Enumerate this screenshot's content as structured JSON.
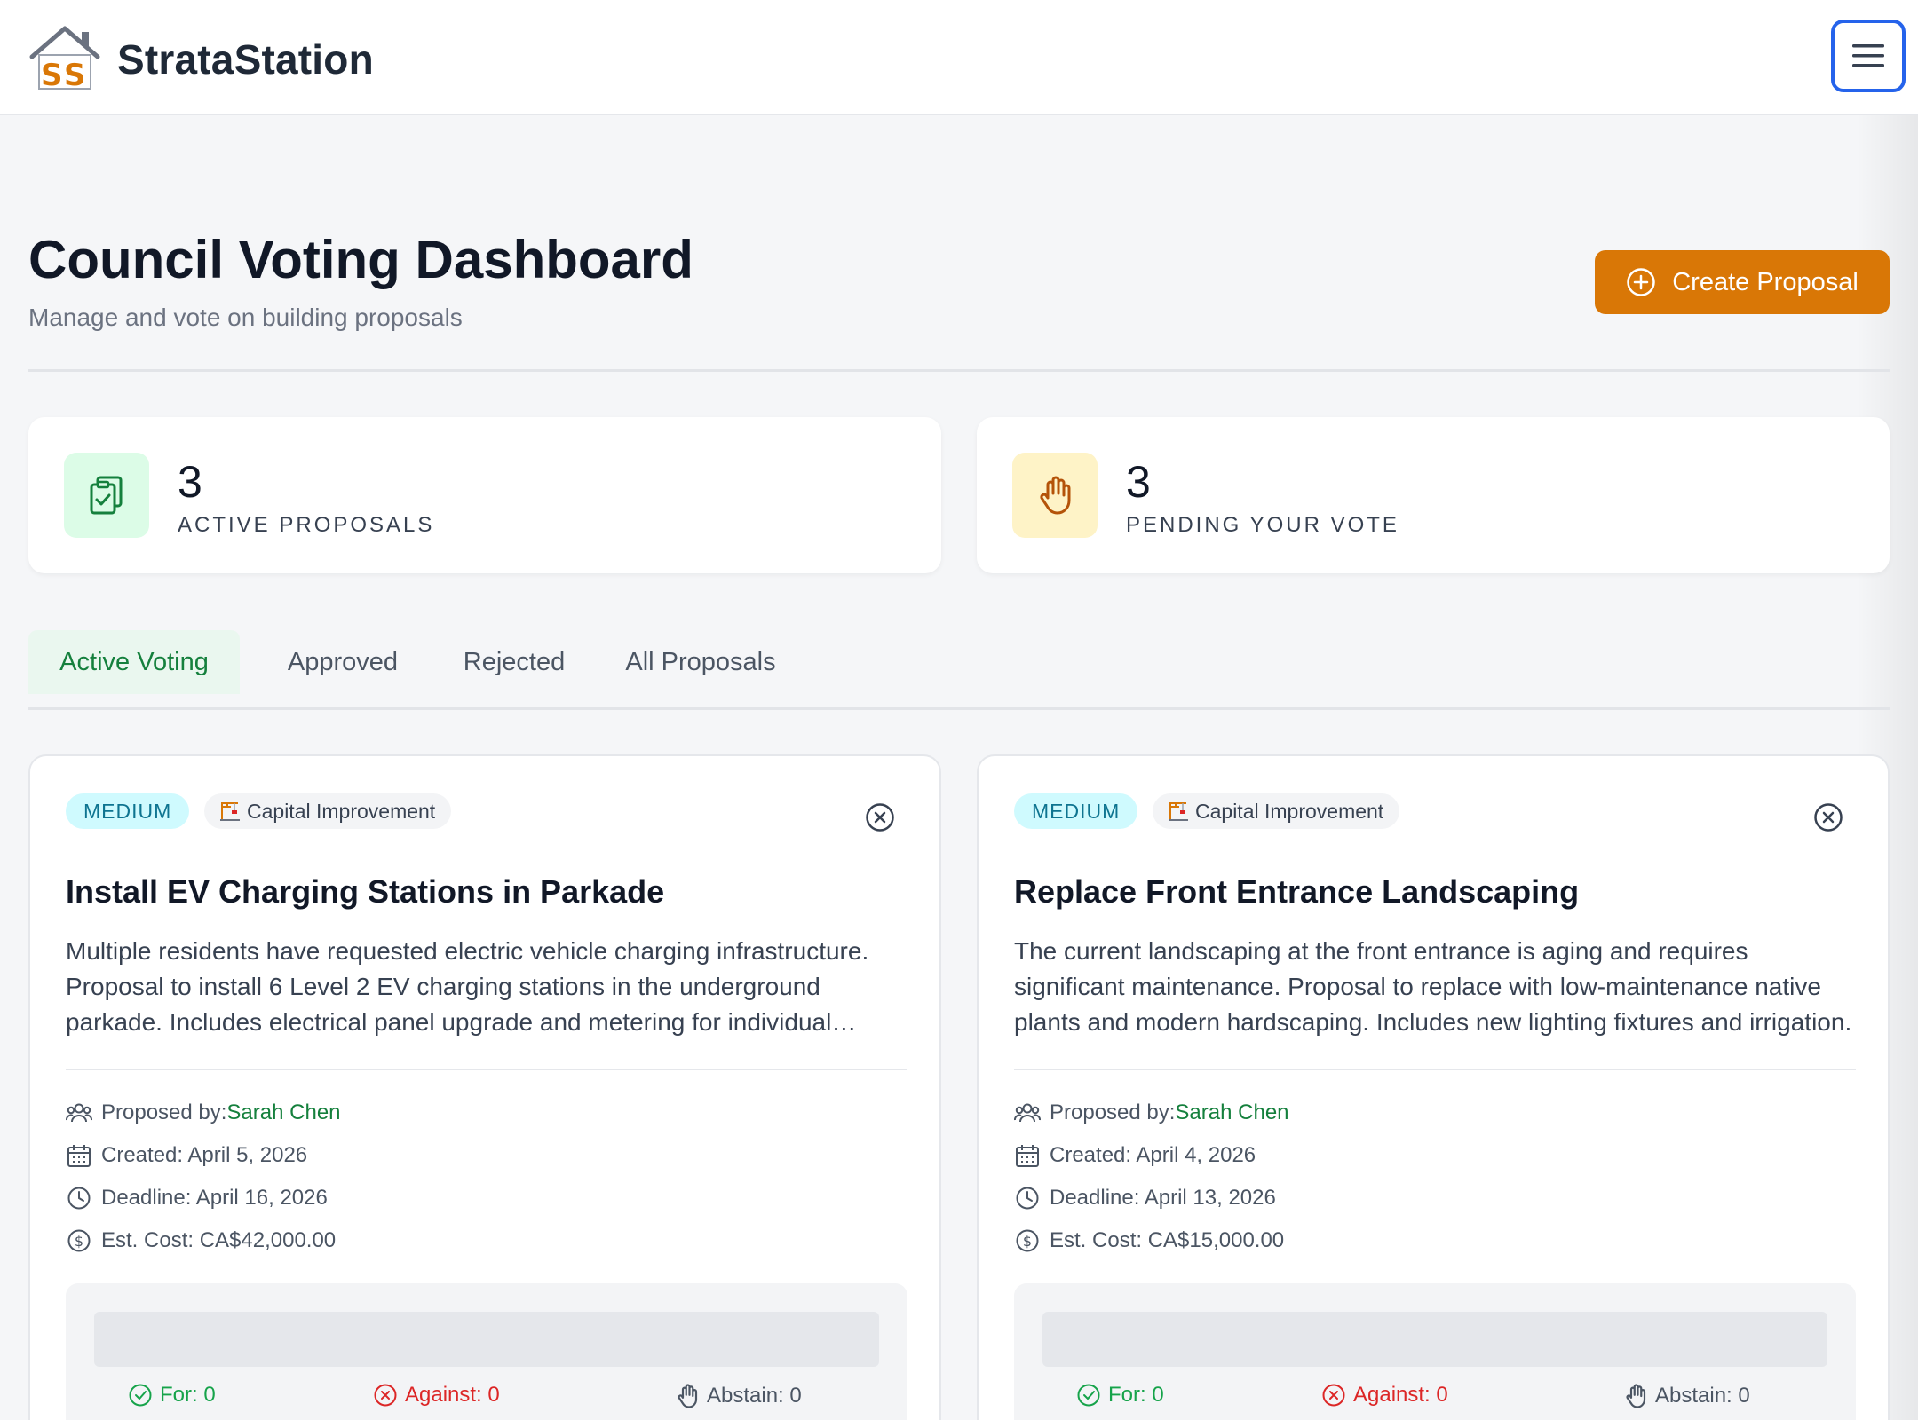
{
  "app": {
    "name": "StrataStation"
  },
  "header": {
    "title": "Council Voting Dashboard",
    "subtitle": "Manage and vote on building proposals",
    "create_button_label": "Create Proposal"
  },
  "stats": [
    {
      "value": "3",
      "label": "ACTIVE PROPOSALS",
      "icon": "clipboard-check-icon",
      "color": "#dcfce7"
    },
    {
      "value": "3",
      "label": "PENDING YOUR VOTE",
      "icon": "raised-hand-icon",
      "color": "#fef3c7"
    }
  ],
  "tabs": [
    {
      "label": "Active Voting",
      "active": true
    },
    {
      "label": "Approved",
      "active": false
    },
    {
      "label": "Rejected",
      "active": false
    },
    {
      "label": "All Proposals",
      "active": false
    }
  ],
  "proposals": [
    {
      "priority": "MEDIUM",
      "category": "Capital Improvement",
      "title": "Install EV Charging Stations in Parkade",
      "description": "Multiple residents have requested electric vehicle charging infrastructure. Proposal to install 6 Level 2 EV charging stations in the underground parkade. Includes electrical panel upgrade and metering for individual billing.",
      "proposed_by_label": "Proposed by:",
      "proposed_by": "Sarah Chen",
      "created": "Created: April 5, 2026",
      "deadline": "Deadline: April 16, 2026",
      "cost": "Est. Cost: CA$42,000.00",
      "votes": {
        "for": "For: 0",
        "against": "Against: 0",
        "abstain": "Abstain: 0"
      }
    },
    {
      "priority": "MEDIUM",
      "category": "Capital Improvement",
      "title": "Replace Front Entrance Landscaping",
      "description": "The current landscaping at the front entrance is aging and requires significant maintenance. Proposal to replace with low-maintenance native plants and modern hardscaping. Includes new lighting fixtures and irrigation.",
      "proposed_by_label": "Proposed by:",
      "proposed_by": "Sarah Chen",
      "created": "Created: April 4, 2026",
      "deadline": "Deadline: April 13, 2026",
      "cost": "Est. Cost: CA$15,000.00",
      "votes": {
        "for": "For: 0",
        "against": "Against: 0",
        "abstain": "Abstain: 0"
      }
    }
  ],
  "colors": {
    "accent": "#d97706",
    "success": "#16a34a",
    "danger": "#dc2626",
    "focus": "#2563eb"
  }
}
